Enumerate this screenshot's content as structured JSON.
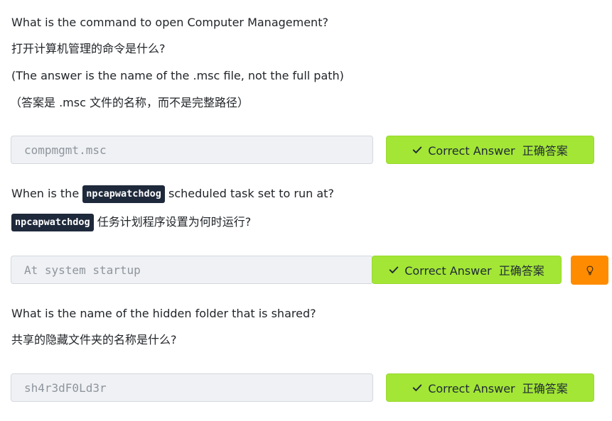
{
  "questions": [
    {
      "q_en": "What is the command to open Computer Management?",
      "q_zh": "打开计算机管理的命令是什么?",
      "note_en": "(The answer is the name of the .msc file, not the full path)",
      "note_zh": "（答案是 .msc 文件的名称，而不是完整路径）",
      "answer": "compmgmt.msc",
      "button_label": "Correct Answer  正确答案"
    },
    {
      "q_en_before": "When is the",
      "q_code": "npcapwatchdog",
      "q_en_after": "scheduled task set to run at?",
      "q_zh_code": "npcapwatchdog",
      "q_zh_after": "任务计划程序设置为何时运行?",
      "answer": "At system startup",
      "button_label": "Correct Answer  正确答案"
    },
    {
      "q_en": "What is the name of the hidden folder that is shared?",
      "q_zh": "共享的隐藏文件夹的名称是什么?",
      "answer": "sh4r3dF0Ld3r",
      "button_label": "Correct Answer  正确答案"
    }
  ],
  "icons": {
    "check": "check-icon",
    "hint": "lightbulb-icon"
  },
  "colors": {
    "correct_bg": "#a3e635",
    "hint_bg": "#ff8c00",
    "code_bg": "#1e293b"
  }
}
